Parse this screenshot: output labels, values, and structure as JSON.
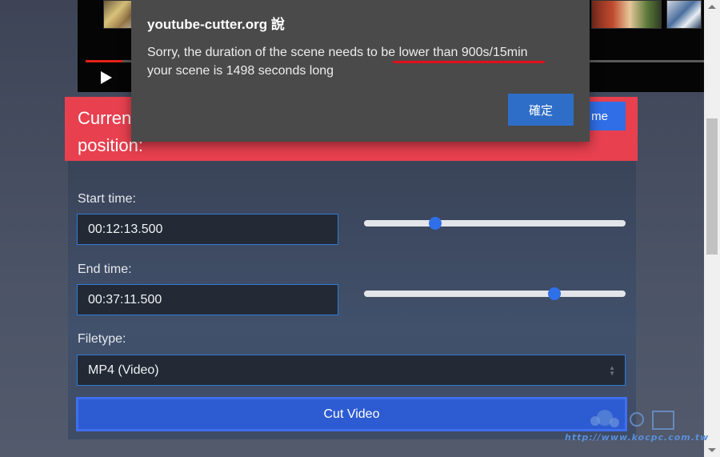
{
  "dialog": {
    "title": "youtube-cutter.org 說",
    "message_line1": "Sorry, the duration of the scene needs to be lower than 900s/15min",
    "message_line2": "your scene is 1498 seconds long",
    "ok_label": "確定"
  },
  "video": {
    "progress_fraction": 0.06
  },
  "banner": {
    "text": "Current position:",
    "button_label": "me"
  },
  "form": {
    "start_label": "Start time:",
    "start_value": "00:12:13.500",
    "start_slider_fraction": 0.26,
    "end_label": "End time:",
    "end_value": "00:37:11.500",
    "end_slider_fraction": 0.74,
    "filetype_label": "Filetype:",
    "filetype_value": "MP4 (Video)",
    "cut_button_label": "Cut Video"
  },
  "watermark": {
    "text": "http://www.kocpc.com.tw"
  },
  "colors": {
    "banner_red": "#e8404f",
    "primary_blue": "#2f6fe8",
    "annotation_red": "#e0101a"
  }
}
